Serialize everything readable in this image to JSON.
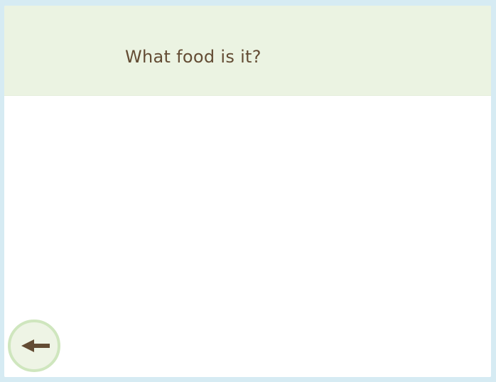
{
  "question": {
    "text": "What food is it?"
  },
  "navigation": {
    "back_icon": "arrow-left-icon"
  },
  "colors": {
    "background": "#d6ebf3",
    "header": "#ebf3e2",
    "text": "#634c34",
    "button_ring": "#cfe6be",
    "button_fill": "#eef4e5"
  }
}
